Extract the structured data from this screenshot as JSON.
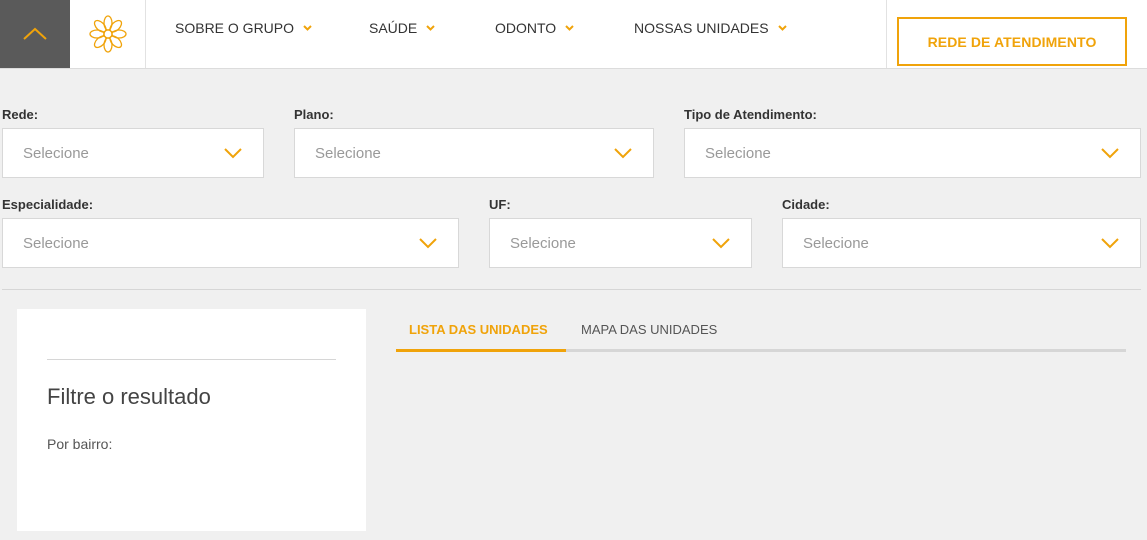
{
  "header": {
    "nav": [
      {
        "label": "SOBRE O GRUPO"
      },
      {
        "label": "SAÚDE"
      },
      {
        "label": "ODONTO"
      },
      {
        "label": "NOSSAS UNIDADES"
      }
    ],
    "cta_label": "REDE DE ATENDIMENTO",
    "back_icon": "chevron-up-icon",
    "logo_icon": "flower-logo-icon"
  },
  "filters": {
    "rede": {
      "label": "Rede:",
      "value": "Selecione"
    },
    "plano": {
      "label": "Plano:",
      "value": "Selecione"
    },
    "tipo": {
      "label": "Tipo de Atendimento:",
      "value": "Selecione"
    },
    "especialidade": {
      "label": "Especialidade:",
      "value": "Selecione"
    },
    "uf": {
      "label": "UF:",
      "value": "Selecione"
    },
    "cidade": {
      "label": "Cidade:",
      "value": "Selecione"
    }
  },
  "results_filter": {
    "title": "Filtre o resultado",
    "by_neighborhood": "Por bairro:"
  },
  "tabs": [
    {
      "label": "LISTA DAS UNIDADES",
      "active": true
    },
    {
      "label": "MAPA DAS UNIDADES",
      "active": false
    }
  ],
  "colors": {
    "accent": "#f0a30a",
    "back_button_bg": "#5a5a5a",
    "page_bg": "#f0f0f0"
  }
}
